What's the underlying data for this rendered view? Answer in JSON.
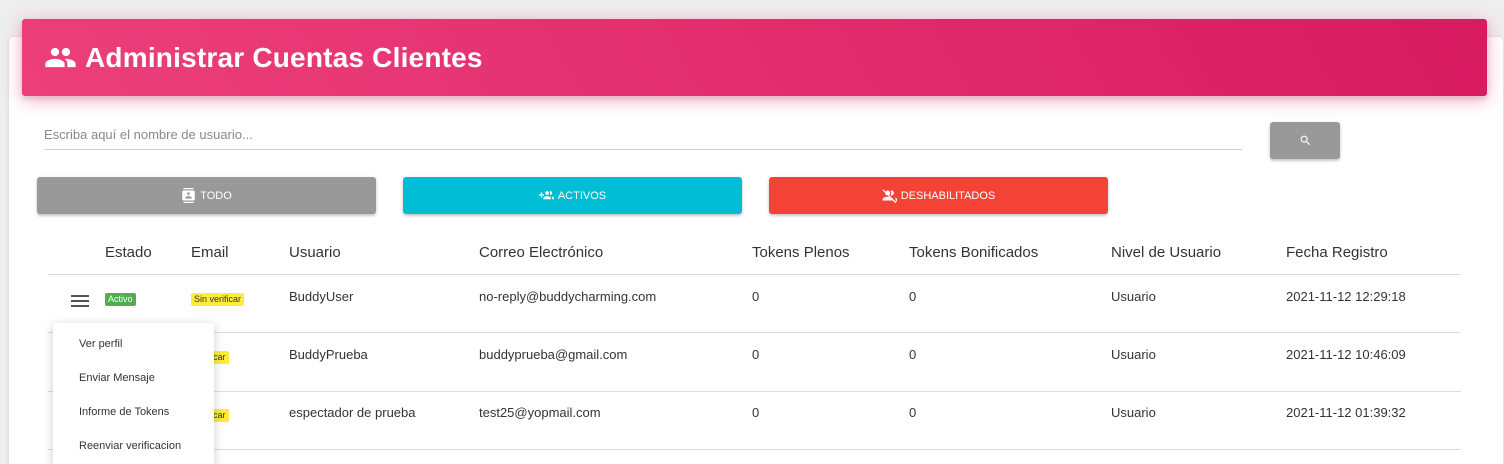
{
  "header": {
    "title": "Administrar Cuentas Clientes",
    "icon": "people-icon"
  },
  "search": {
    "placeholder": "Escriba aquí el nombre de usuario...",
    "value": ""
  },
  "filters": [
    {
      "label": "TODO",
      "icon": "contact-card-icon",
      "color": "#999999"
    },
    {
      "label": "ACTIVOS",
      "icon": "add-group-icon",
      "color": "#00bcd4"
    },
    {
      "label": "DESHABILITADOS",
      "icon": "disabled-user-icon",
      "color": "#f44336"
    }
  ],
  "table": {
    "columns": [
      "Estado",
      "Email",
      "Usuario",
      "Correo Electrónico",
      "Tokens Plenos",
      "Tokens Bonificados",
      "Nivel de Usuario",
      "Fecha Registro"
    ],
    "rows": [
      {
        "estado": "Activo",
        "email": "Sin verificar",
        "usuario": "BuddyUser",
        "correo": "no-reply@buddycharming.com",
        "tokens_plenos": "0",
        "tokens_bonificados": "0",
        "nivel": "Usuario",
        "fecha": "2021-11-12 12:29:18"
      },
      {
        "estado": "",
        "email": "verificar",
        "usuario": "BuddyPrueba",
        "correo": "buddyprueba@gmail.com",
        "tokens_plenos": "0",
        "tokens_bonificados": "0",
        "nivel": "Usuario",
        "fecha": "2021-11-12 10:46:09"
      },
      {
        "estado": "",
        "email": "verificar",
        "usuario": "espectador de prueba",
        "correo": "test25@yopmail.com",
        "tokens_plenos": "0",
        "tokens_bonificados": "0",
        "nivel": "Usuario",
        "fecha": "2021-11-12 01:39:32"
      }
    ]
  },
  "row_menu": {
    "items": [
      "Ver perfil",
      "Enviar Mensaje",
      "Informe de Tokens",
      "Reenviar verificacion"
    ]
  },
  "colors": {
    "header_start": "#ec407a",
    "header_end": "#d81b60",
    "badge_active": "#4caf50",
    "badge_unverified": "#ffeb3b"
  }
}
